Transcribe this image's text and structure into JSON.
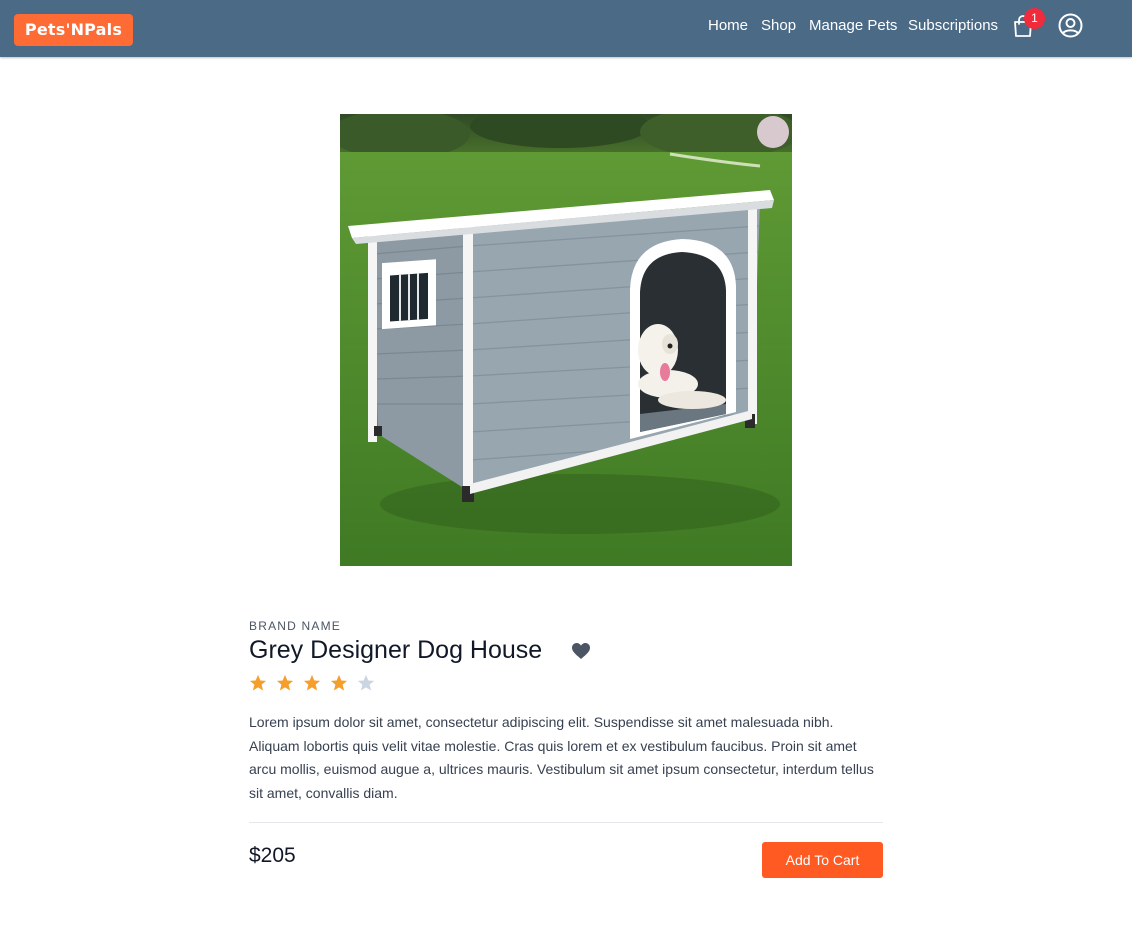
{
  "header": {
    "logo_text": "Pets'NPals",
    "nav": [
      {
        "label": "Home"
      },
      {
        "label": "Shop"
      },
      {
        "label": "Manage Pets"
      },
      {
        "label": "Subscriptions"
      }
    ],
    "cart_count": "1",
    "icons": {
      "cart": "shopping-bag-icon",
      "account": "user-circle-icon"
    }
  },
  "product": {
    "image_icon": "dog-house-photo",
    "brand": "BRAND NAME",
    "title": "Grey Designer Dog House",
    "rating": 4,
    "rating_max": 5,
    "description": "Lorem ipsum dolor sit amet, consectetur adipiscing elit. Suspendisse sit amet malesuada nibh. Aliquam lobortis quis velit vitae molestie. Cras quis lorem et ex vestibulum faucibus. Proin sit amet arcu mollis, euismod augue a, ultrices mauris. Vestibulum sit amet ipsum consectetur, interdum tellus sit amet, convallis diam.",
    "price": "$205",
    "add_to_cart_label": "Add To Cart"
  },
  "colors": {
    "navbar": "#4a6a86",
    "brand_accent": "#ff6b35",
    "button": "#ff5a22",
    "star_filled": "#f59e2b",
    "star_empty": "#cbd5e1",
    "badge": "#ef2b3c"
  }
}
